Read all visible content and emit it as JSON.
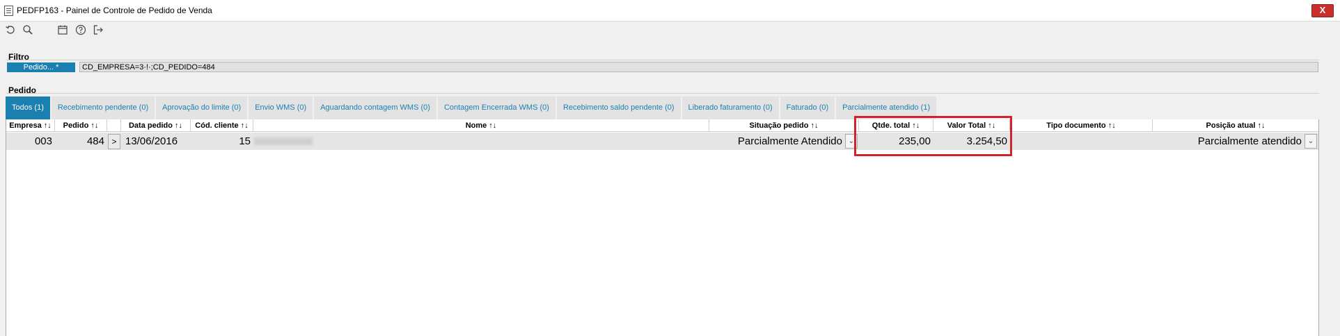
{
  "window": {
    "title": "PEDFP163 - Painel de Controle de Pedido de Venda",
    "close_label": "X"
  },
  "toolbar": {
    "icons": [
      "refresh-icon",
      "search-icon",
      "calendar-icon",
      "help-icon",
      "exit-icon"
    ]
  },
  "filter": {
    "section_label": "Filtro",
    "field_label": "Pedido... *",
    "value": "CD_EMPRESA=3·!·;CD_PEDIDO=484"
  },
  "orders": {
    "section_label": "Pedido",
    "tabs": [
      {
        "label": "Todos (1)",
        "active": true
      },
      {
        "label": "Recebimento pendente (0)"
      },
      {
        "label": "Aprovação do limite (0)"
      },
      {
        "label": "Envio WMS (0)"
      },
      {
        "label": "Aguardando contagem WMS (0)"
      },
      {
        "label": "Contagem Encerrada WMS (0)"
      },
      {
        "label": "Recebimento saldo pendente (0)"
      },
      {
        "label": "Liberado faturamento (0)"
      },
      {
        "label": "Faturado (0)"
      },
      {
        "label": "Parcialmente atendido (1)"
      }
    ],
    "columns": {
      "empresa": "Empresa ↑↓",
      "pedido": "Pedido ↑↓",
      "data_pedido": "Data pedido ↑↓",
      "cod_cliente": "Cód. cliente ↑↓",
      "nome": "Nome ↑↓",
      "situacao": "Situação pedido ↑↓",
      "qtde_total": "Qtde. total ↑↓",
      "valor_total": "Valor Total ↑↓",
      "tipo_documento": "Tipo documento ↑↓",
      "posicao_atual": "Posição atual ↑↓"
    },
    "rows": [
      {
        "empresa": "003",
        "pedido": "484",
        "expand": ">",
        "data_pedido": "13/06/2016",
        "cod_cliente": "15",
        "situacao": "Parcialmente Atendido",
        "qtde_total": "235,00",
        "valor_total": "3.254,50",
        "tipo_documento": "",
        "posicao_atual": "Parcialmente atendido"
      }
    ]
  },
  "colors": {
    "accent": "#1b7fb0",
    "highlight": "#d2232a",
    "close": "#c9302c"
  }
}
